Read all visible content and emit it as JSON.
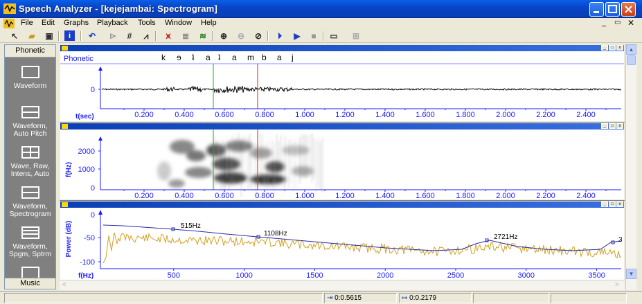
{
  "window": {
    "title": "Speech Analyzer - [kejejambai: Spectrogram]"
  },
  "menu": [
    "File",
    "Edit",
    "Graphs",
    "Playback",
    "Tools",
    "Window",
    "Help"
  ],
  "left_panel": {
    "header": "Phonetic",
    "items": [
      "Waveform",
      "Waveform, Auto Pitch",
      "Wave, Raw, Intens, Auto",
      "Waveform, Spectrogram",
      "Waveform, Spgm, Sptrm"
    ],
    "footer": "Music"
  },
  "waveform_pane": {
    "row_label": "Phonetic",
    "phonetic_symbols": [
      "k",
      "ɘ",
      "ʇ",
      "a",
      "ʇ",
      "a",
      "m",
      "b",
      "a",
      "j"
    ],
    "y_tick": "0",
    "x_label": "t(sec)",
    "x_ticks": [
      "0.200",
      "0.400",
      "0.600",
      "0.800",
      "1.000",
      "1.200",
      "1.400",
      "1.600",
      "1.800",
      "2.000",
      "2.200",
      "2.400"
    ]
  },
  "spectrogram_pane": {
    "y_label": "f(Hz)",
    "y_ticks": [
      "2000",
      "1000",
      "0"
    ],
    "x_ticks": [
      "0.200",
      "0.400",
      "0.600",
      "0.800",
      "1.000",
      "1.200",
      "1.400",
      "1.600",
      "1.800",
      "2.000",
      "2.200",
      "2.400"
    ]
  },
  "spectrum_pane": {
    "y_label": "Power (dB)",
    "y_ticks": [
      "0",
      "-50",
      "-100"
    ],
    "x_label": "f(Hz)",
    "x_ticks": [
      "500",
      "1000",
      "1500",
      "2000",
      "2500",
      "3000",
      "3500"
    ],
    "formants": [
      "515Hz",
      "1108Hz",
      "2721Hz",
      "3"
    ]
  },
  "cursors": {
    "start_color": "#22aa22",
    "stop_color": "#dd2222"
  },
  "status": {
    "position": "0:0.5615",
    "length": "0:0.2179"
  },
  "colors": {
    "titlebar": "#0a3fb6",
    "plot_blue": "#1a1aff",
    "spectrum_orange": "#d4a020",
    "envelope": "#2a2aa8"
  }
}
